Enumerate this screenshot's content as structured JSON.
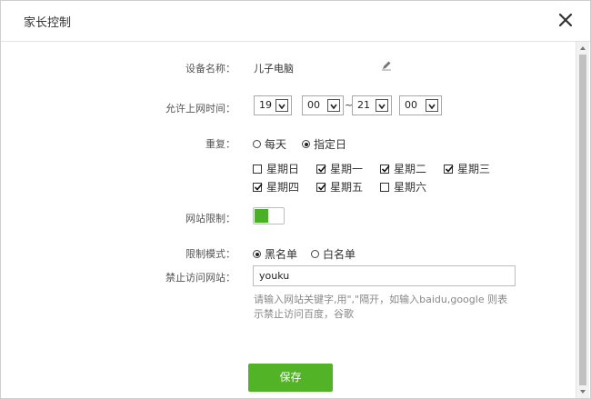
{
  "dialog": {
    "title": "家长控制",
    "close_icon": "close-icon"
  },
  "device": {
    "label": "设备名称：",
    "value": "儿子电脑",
    "edit_icon": "pencil-icon"
  },
  "time": {
    "label": "允许上网时间：",
    "start_hour": "19",
    "start_minute": "00",
    "separator": "~",
    "end_hour": "21",
    "end_minute": "00"
  },
  "repeat": {
    "label": "重复：",
    "options": [
      {
        "label": "每天",
        "selected": false
      },
      {
        "label": "指定日",
        "selected": true
      }
    ],
    "days": [
      {
        "label": "星期日",
        "checked": false
      },
      {
        "label": "星期一",
        "checked": true
      },
      {
        "label": "星期二",
        "checked": true
      },
      {
        "label": "星期三",
        "checked": true
      },
      {
        "label": "星期四",
        "checked": true
      },
      {
        "label": "星期五",
        "checked": true
      },
      {
        "label": "星期六",
        "checked": false
      }
    ]
  },
  "site_limit": {
    "label": "网站限制：",
    "enabled": true,
    "accent": "#52b327"
  },
  "mode": {
    "label": "限制模式：",
    "options": [
      {
        "label": "黑名单",
        "selected": true
      },
      {
        "label": "白名单",
        "selected": false
      }
    ]
  },
  "blocked": {
    "label": "禁止访问网站：",
    "value": "youku",
    "hint_line1": "请输入网站关键字,用\",\"隔开，如输入baidu,google 则表",
    "hint_line2": "示禁止访问百度，谷歌"
  },
  "save_label": "保存"
}
